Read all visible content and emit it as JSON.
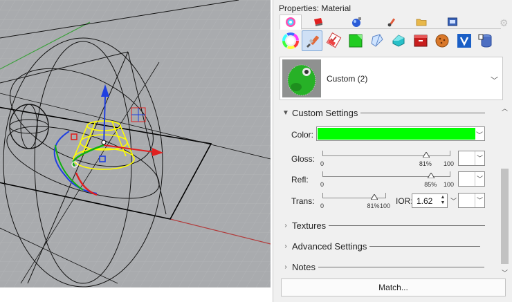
{
  "panel": {
    "title": "Properties: Material",
    "material_name": "Custom (2)",
    "match_label": "Match..."
  },
  "tabs": [
    "material-sphere-icon",
    "layer-folder-icon",
    "render-sphere-icon",
    "brush-icon",
    "folder-icon",
    "display-icon"
  ],
  "toolbar_icons": [
    "color-wheel-icon",
    "paint-brush-icon",
    "texture-check-icon",
    "green-plane-icon",
    "glass-cube-icon",
    "teal-shape-icon",
    "red-box-icon",
    "cookie-icon",
    "v-logo-icon",
    "database-icon"
  ],
  "sections": {
    "custom_settings": "Custom Settings",
    "textures": "Textures",
    "advanced_settings": "Advanced Settings",
    "notes": "Notes"
  },
  "color": {
    "label": "Color:",
    "value": "#00ff00"
  },
  "gloss": {
    "label": "Gloss:",
    "min": "0",
    "max": "100",
    "value_label": "81%",
    "value": 0.81
  },
  "refl": {
    "label": "Refl:",
    "min": "0",
    "max": "100",
    "value_label": "85%",
    "value": 0.85
  },
  "trans": {
    "label": "Trans:",
    "min": "0",
    "max": "100",
    "value_label": "81%",
    "value": 0.81
  },
  "ior": {
    "label": "IOR:",
    "value": "1.62"
  }
}
